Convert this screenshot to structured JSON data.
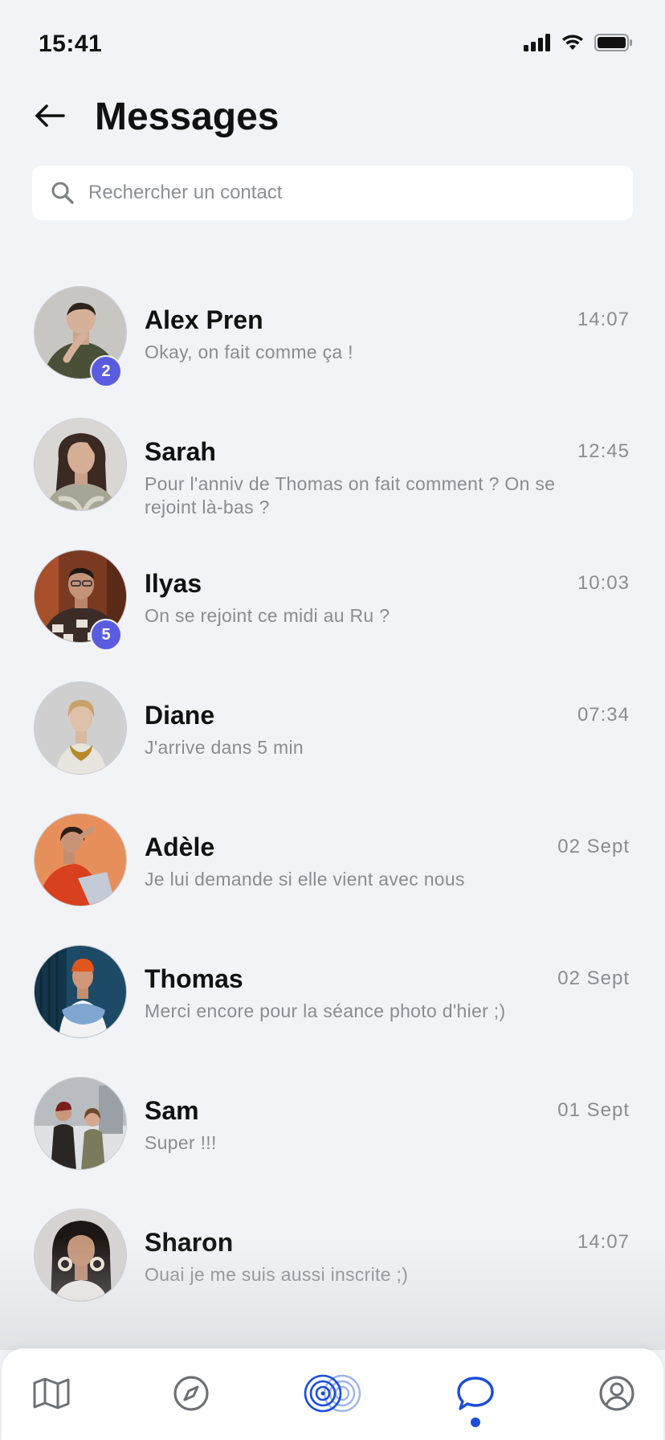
{
  "status_bar": {
    "time": "15:41"
  },
  "header": {
    "title": "Messages"
  },
  "search": {
    "placeholder": "Rechercher un contact"
  },
  "colors": {
    "accent": "#1a4ed8",
    "badge": "#5a5ce0",
    "background": "#f2f3f6"
  },
  "conversations": [
    {
      "name": "Alex Pren",
      "preview": "Okay, on fait comme ça !",
      "time": "14:07",
      "unread": "2"
    },
    {
      "name": "Sarah",
      "preview": "Pour l'anniv de Thomas on fait comment ? On se rejoint là-bas ?",
      "time": "12:45",
      "unread": ""
    },
    {
      "name": "Ilyas",
      "preview": "On se rejoint ce midi au Ru ?",
      "time": "10:03",
      "unread": "5"
    },
    {
      "name": "Diane",
      "preview": "J'arrive dans  5 min",
      "time": "07:34",
      "unread": ""
    },
    {
      "name": "Adèle",
      "preview": "Je lui demande si elle vient avec nous",
      "time": "02 Sept",
      "unread": ""
    },
    {
      "name": "Thomas",
      "preview": "Merci encore pour la séance photo d'hier ;)",
      "time": "02 Sept",
      "unread": ""
    },
    {
      "name": "Sam",
      "preview": "Super !!!",
      "time": "01 Sept",
      "unread": ""
    },
    {
      "name": "Sharon",
      "preview": "Ouai je me suis aussi inscrite ;)",
      "time": "14:07",
      "unread": ""
    }
  ],
  "bottom_nav": {
    "items": [
      "map-icon",
      "compass-icon",
      "radar-icon",
      "chat-bubble-icon",
      "profile-icon"
    ],
    "active": "chat-bubble-icon"
  }
}
